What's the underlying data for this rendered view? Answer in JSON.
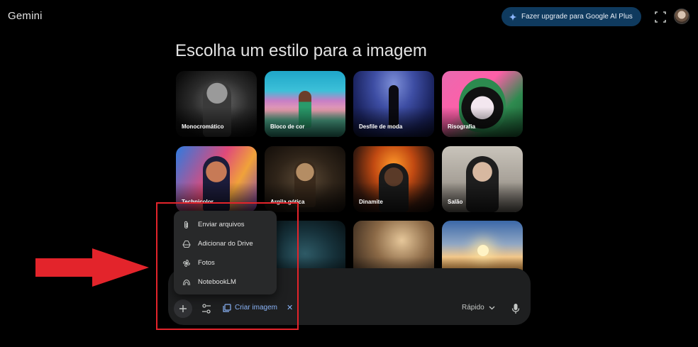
{
  "header": {
    "brand": "Gemini",
    "upgrade_label": "Fazer upgrade para Google AI Plus",
    "colors": {
      "upgrade_bg": "#0f3a5e",
      "accent": "#8ab4f8"
    }
  },
  "main": {
    "title": "Escolha um estilo para a imagem",
    "styles": [
      {
        "label": "Monocromático"
      },
      {
        "label": "Bloco de cor"
      },
      {
        "label": "Desfile de moda"
      },
      {
        "label": "Risografia"
      },
      {
        "label": "Technicolor"
      },
      {
        "label": "Argila gótica"
      },
      {
        "label": "Dinamite"
      },
      {
        "label": "Salão"
      },
      {
        "label": ""
      },
      {
        "label": ""
      },
      {
        "label": ""
      }
    ]
  },
  "menu": {
    "items": [
      {
        "label": "Enviar arquivos",
        "icon": "paperclip-icon"
      },
      {
        "label": "Adicionar do Drive",
        "icon": "drive-icon"
      },
      {
        "label": "Fotos",
        "icon": "photos-pinwheel-icon"
      },
      {
        "label": "NotebookLM",
        "icon": "notebooklm-icon"
      }
    ]
  },
  "composer": {
    "chip_label": "Criar imagem",
    "mode_label": "Rápido"
  },
  "annotation": {
    "color": "#e3242b"
  }
}
